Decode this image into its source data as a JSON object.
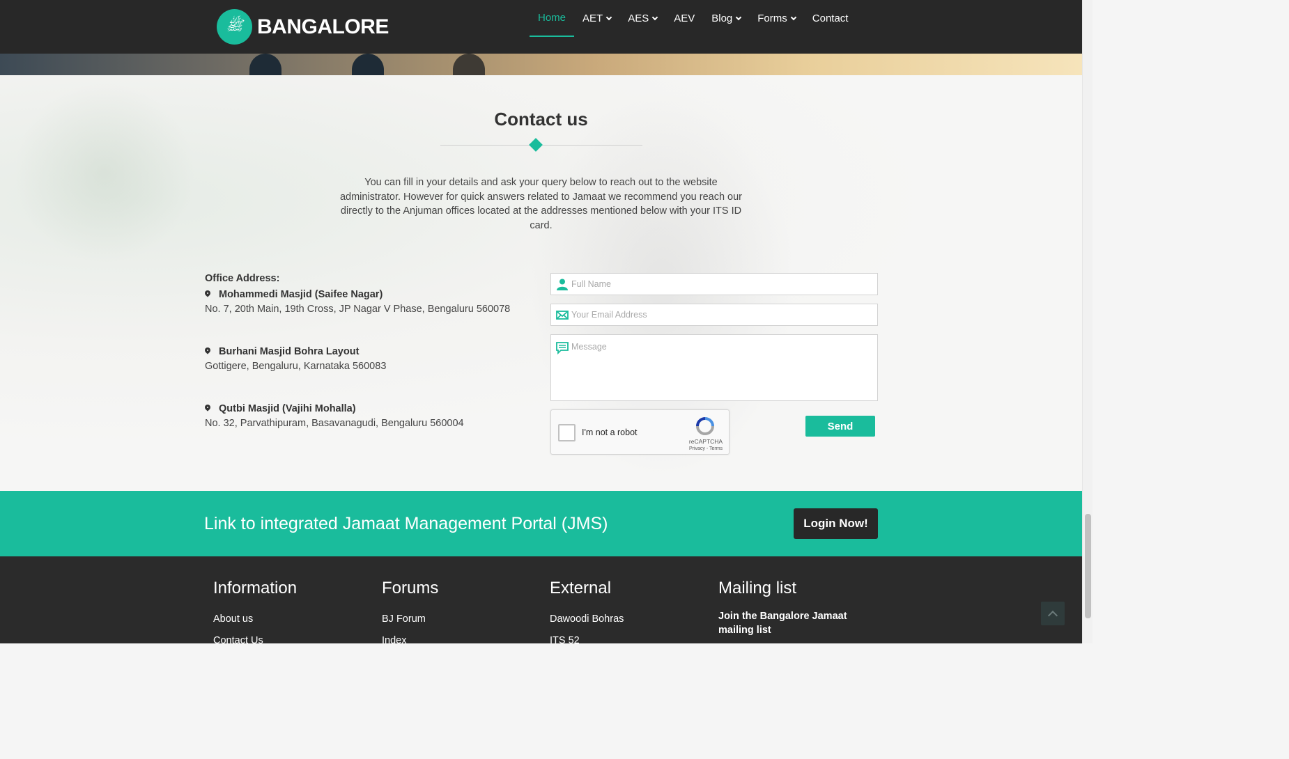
{
  "brand": {
    "logo_text": "ﷺ",
    "name": "BANGALORE"
  },
  "nav": {
    "items": [
      {
        "label": "Home",
        "active": true,
        "dropdown": false
      },
      {
        "label": "AET",
        "dropdown": true
      },
      {
        "label": "AES",
        "dropdown": true
      },
      {
        "label": "AEV",
        "dropdown": false
      },
      {
        "label": "Blog",
        "dropdown": true
      },
      {
        "label": "Forms",
        "dropdown": true
      },
      {
        "label": "Contact",
        "dropdown": false
      }
    ]
  },
  "contact": {
    "title": "Contact us",
    "intro": "You can fill in your details and ask your query below to reach out to the website administrator. However for quick answers related to Jamaat we recommend you reach our directly to the Anjuman offices located at the addresses mentioned below with your ITS ID card.",
    "office_heading": "Office Address:",
    "offices": [
      {
        "name": "Mohammedi Masjid (Saifee Nagar)",
        "address": "No. 7, 20th Main, 19th Cross, JP Nagar V Phase, Bengaluru 560078"
      },
      {
        "name": "Burhani Masjid Bohra Layout",
        "address": "Gottigere, Bengaluru, Karnataka 560083"
      },
      {
        "name": "Qutbi Masjid (Vajihi Mohalla)",
        "address": "No. 32, Parvathipuram, Basavanagudi, Bengaluru 560004"
      }
    ],
    "form": {
      "name_placeholder": "Full Name",
      "email_placeholder": "Your Email Address",
      "message_placeholder": "Message",
      "send_label": "Send"
    },
    "recaptcha": {
      "label": "I'm not a robot",
      "brand": "reCAPTCHA",
      "links": "Privacy - Terms"
    }
  },
  "jms": {
    "text": "Link to integrated Jamaat Management Portal (JMS)",
    "button": "Login Now!"
  },
  "footer": {
    "columns": [
      {
        "title": "Information",
        "links": [
          "About us",
          "Contact Us"
        ]
      },
      {
        "title": "Forums",
        "links": [
          "BJ Forum",
          "Index"
        ]
      },
      {
        "title": "External",
        "links": [
          "Dawoodi Bohras",
          "ITS 52"
        ]
      },
      {
        "title": "Mailing list",
        "text": "Join the Bangalore Jamaat mailing list"
      }
    ]
  },
  "colors": {
    "accent": "#1abc9c",
    "nav_bg": "#282828",
    "footer_bg": "#2b2b2b"
  }
}
